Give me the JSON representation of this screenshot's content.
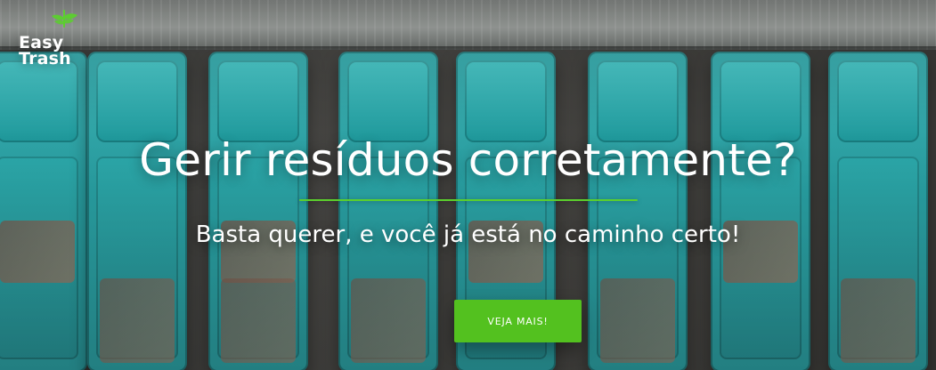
{
  "brand": {
    "line1": "Easy",
    "line2": "Trash",
    "icon": "leaf-icon",
    "accent_color": "#5bd02d"
  },
  "hero": {
    "title": "Gerir resíduos corretamente?",
    "subtitle": "Basta querer, e você já está no caminho certo!",
    "cta_label": "VEJA MAIS!",
    "cta_color": "#53c11f"
  }
}
